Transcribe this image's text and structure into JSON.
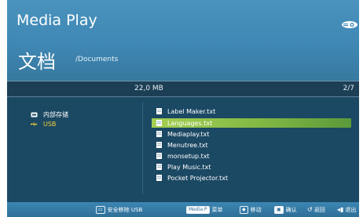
{
  "header": {
    "app_title": "Media Play",
    "folder_title": "文档",
    "folder_path": "/Documents",
    "logo_icon": "projector-logo-icon"
  },
  "infobar": {
    "size": "22,0 MB",
    "page": "2/7"
  },
  "storage": {
    "items": [
      {
        "label": "内部存储",
        "icon": "internal-storage-icon",
        "selected": false
      },
      {
        "label": "USB",
        "icon": "usb-icon",
        "selected": true
      }
    ]
  },
  "files": {
    "items": [
      {
        "name": "Label Maker.txt",
        "selected": false
      },
      {
        "name": "Languages.txt",
        "selected": true
      },
      {
        "name": "Mediaplay.txt",
        "selected": false
      },
      {
        "name": "Menutree.txt",
        "selected": false
      },
      {
        "name": "monsetup.txt",
        "selected": false
      },
      {
        "name": "Play Music.txt",
        "selected": false
      },
      {
        "name": "Pocket Projector.txt",
        "selected": false
      }
    ]
  },
  "footer": {
    "safe_remove_key": "▭",
    "safe_remove_label": "安全移除 USB",
    "menu_key": "Media P",
    "menu_label": "菜单",
    "move_key": "◆",
    "move_label": "移动",
    "confirm_key": "▣",
    "confirm_label": "确认",
    "back_key": "↺",
    "back_label": "返回",
    "exit_key": "◂▮",
    "exit_label": "退出"
  },
  "colors": {
    "header_bg": "#4a93be",
    "content_bg": "#1b4863",
    "selected_bg": "#a5cf54",
    "usb_text": "#f2cf3a"
  }
}
